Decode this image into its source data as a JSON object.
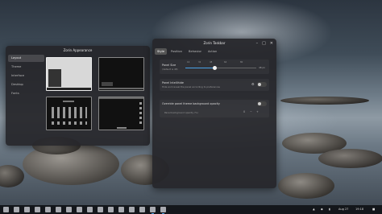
{
  "appearance_window": {
    "title": "Zorin Appearance",
    "sidebar": [
      "Layout",
      "Theme",
      "Interface",
      "Desktop",
      "Fonts"
    ]
  },
  "taskbar_window": {
    "title": "Zorin Taskbar",
    "tabs": [
      "Style",
      "Position",
      "Behavior",
      "Action"
    ],
    "panel_size": {
      "label": "Panel Size",
      "sublabel": "(default is 48)",
      "ticks": [
        "16",
        "32",
        "48",
        "64",
        "80"
      ],
      "value_text": "48 px",
      "fraction": 0.42
    },
    "panel_intellihide": {
      "label": "Panel Intellihide",
      "sublabel": "Hide and reveal the panel according to preferences"
    },
    "override_opacity": {
      "label": "Override panel theme background opacity",
      "sub_row": "Panel background opacity (%)",
      "value": "0"
    }
  },
  "panel": {
    "date": "Aug 27",
    "time": "19:18"
  },
  "colors": {
    "accent": "#4aa3e8",
    "panel_bg": "#121418"
  }
}
